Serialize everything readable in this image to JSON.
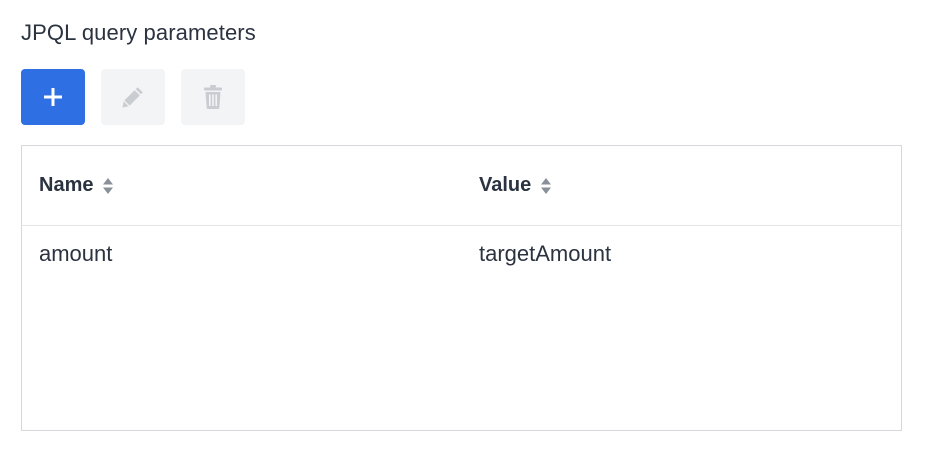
{
  "section": {
    "title": "JPQL query parameters"
  },
  "toolbar": {
    "buttons": [
      {
        "icon": "plus-icon",
        "state": "enabled",
        "color": "#2f6fe4"
      },
      {
        "icon": "pencil-icon",
        "state": "disabled"
      },
      {
        "icon": "trash-icon",
        "state": "disabled"
      }
    ]
  },
  "table": {
    "columns": [
      {
        "label": "Name",
        "sortable": true
      },
      {
        "label": "Value",
        "sortable": true
      }
    ],
    "rows": [
      {
        "name": "amount",
        "value": "targetAmount"
      }
    ]
  }
}
